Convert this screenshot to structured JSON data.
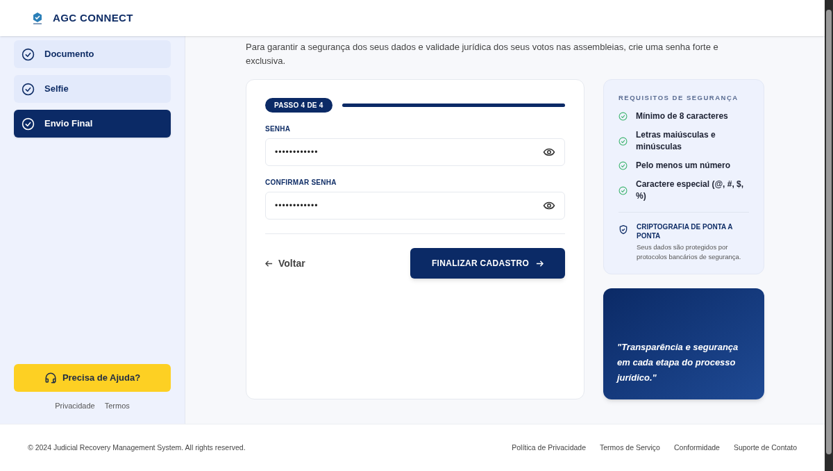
{
  "header": {
    "brand": "AGC CONNECT"
  },
  "sidebar": {
    "steps": [
      {
        "label": "Documento",
        "selected": false
      },
      {
        "label": "Selfie",
        "selected": false
      },
      {
        "label": "Envio Final",
        "selected": true
      }
    ],
    "help_button": "Precisa de Ajuda?",
    "links": [
      "Privacidade",
      "Termos"
    ]
  },
  "intro": "Para garantir a segurança dos seus dados e validade jurídica dos seus votos nas assembleias, crie uma senha forte e exclusiva.",
  "form": {
    "step_badge": "PASSO 4 DE 4",
    "progress": {
      "level": 1
    },
    "fields": [
      {
        "label": "SENHA",
        "value": "••••••••••••"
      },
      {
        "label": "CONFIRMAR SENHA",
        "value": "••••••••••••"
      }
    ],
    "back": "Voltar",
    "submit": "FINALIZAR CADASTRO"
  },
  "requirements": {
    "title": "REQUISITOS DE SEGURANÇA",
    "items": [
      {
        "text": "Mínimo de 8 caracteres",
        "met": true
      },
      {
        "text": "Letras maiúsculas e minúsculas",
        "met": true
      },
      {
        "text": "Pelo menos um número",
        "met": true
      },
      {
        "text": "Caractere especial (@, #, $, %)",
        "met": true
      }
    ],
    "encryption_title": "CRIPTOGRAFIA DE PONTA A PONTA",
    "encryption_text": "Seus dados são protegidos por protocolos bancários de segurança."
  },
  "quote": "\"Transparência e segurança em cada etapa do processo jurídico.\"",
  "footer": {
    "copyright": "© 2024 Judicial Recovery Management System. All rights reserved.",
    "links": [
      "Política de Privacidade",
      "Termos de Serviço",
      "Conformidade",
      "Suporte de Contato"
    ]
  }
}
